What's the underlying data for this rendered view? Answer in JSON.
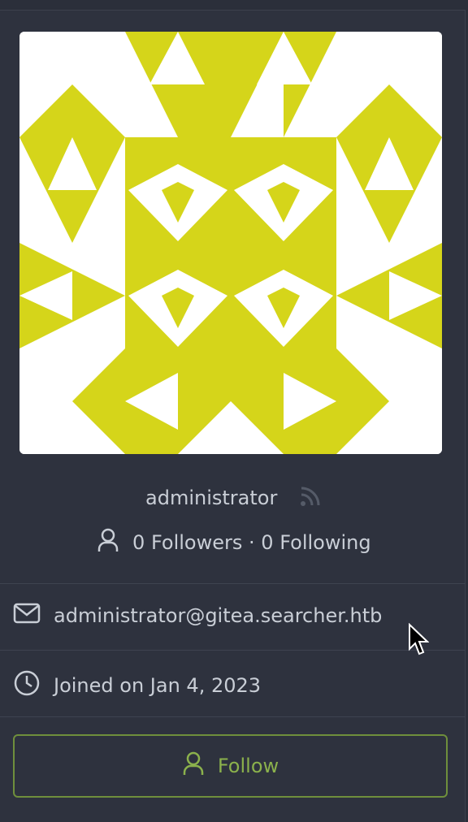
{
  "profile": {
    "username": "administrator",
    "followers": "0 Followers",
    "separator": "·",
    "following": "0 Following",
    "email": "administrator@gitea.searcher.htb",
    "joined": "Joined on Jan 4, 2023",
    "follow_label": "Follow"
  },
  "icons": {
    "rss": "rss-icon",
    "people": "person-icon",
    "email": "mail-icon",
    "joined": "clock-icon",
    "follow": "person-icon"
  },
  "colors": {
    "avatar_fill": "#d5d51a",
    "accent_green": "#8bb14c",
    "background": "#2e323e"
  }
}
